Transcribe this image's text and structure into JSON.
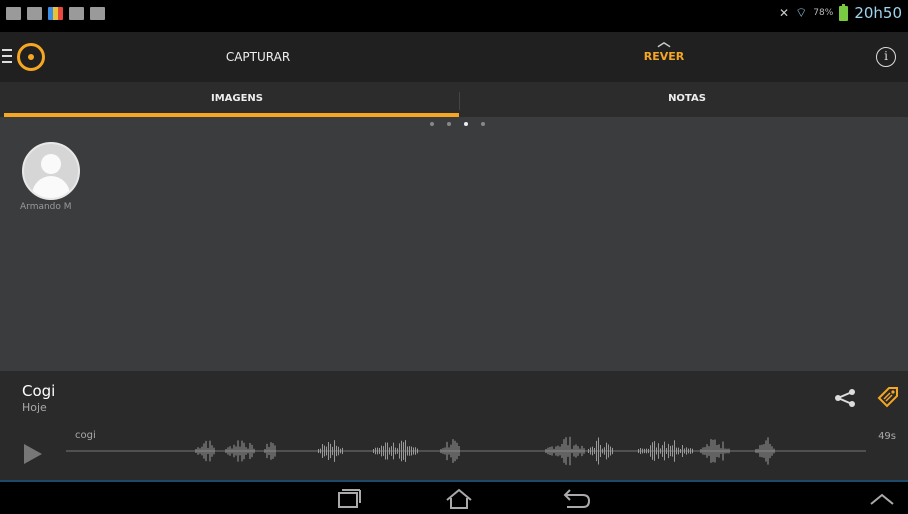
{
  "status_bar": {
    "clock": "20h50",
    "battery_percent": "78%",
    "battery_level": 0.78
  },
  "action_bar": {
    "tabs": [
      {
        "label": "CAPTURAR"
      },
      {
        "label": "REVER",
        "active": true
      }
    ],
    "accent_color": "#f5a623"
  },
  "sub_tabs": [
    {
      "label": "IMAGENS",
      "active": true
    },
    {
      "label": "NOTAS",
      "active": false
    }
  ],
  "pager": {
    "count": 4,
    "active_index": 2
  },
  "contacts": [
    {
      "name": "Armando M"
    }
  ],
  "recording": {
    "title": "Cogi",
    "date": "Hoje",
    "track_label": "cogi",
    "duration": "49s"
  },
  "icons": {
    "menu": "menu-lines-icon",
    "logo": "app-logo-icon",
    "info": "info-icon",
    "share": "share-icon",
    "tag": "tag-icon",
    "play": "play-icon",
    "recents": "recents-icon",
    "home": "home-icon",
    "back": "back-icon",
    "up": "chevron-up-icon"
  }
}
